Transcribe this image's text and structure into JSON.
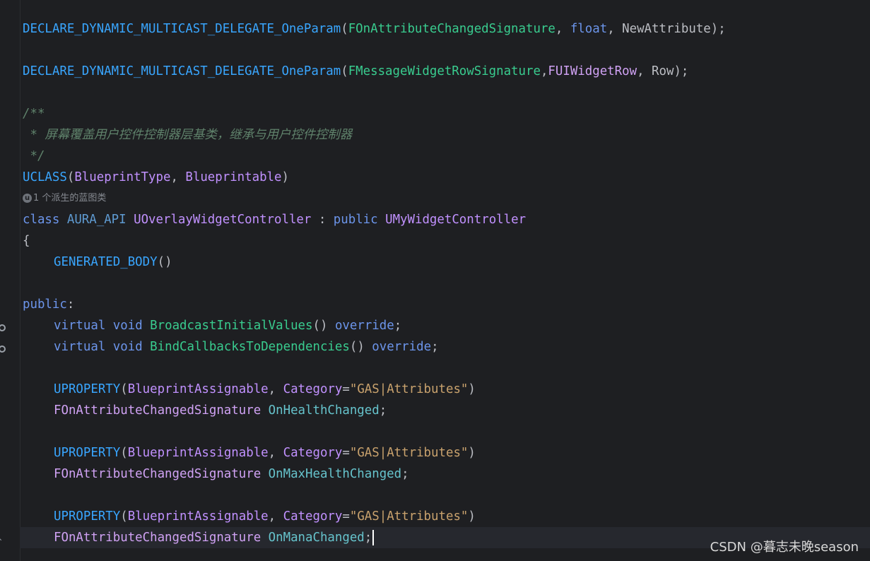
{
  "code": {
    "delegate1": {
      "macro": "DECLARE_DYNAMIC_MULTICAST_DELEGATE_OneParam",
      "open": "(",
      "sig": "FOnAttributeChangedSignature",
      "sep1": ", ",
      "ptype": "float",
      "sep2": ", ",
      "pname": "NewAttribute",
      "close": ");"
    },
    "delegate2": {
      "macro": "DECLARE_DYNAMIC_MULTICAST_DELEGATE_OneParam",
      "open": "(",
      "sig": "FMessageWidgetRowSignature",
      "sep1": ",",
      "ptype": "FUIWidgetRow",
      "sep2": ", ",
      "pname": "Row",
      "close": ");"
    },
    "comment": {
      "open": "/**",
      "body": " * 屏幕覆盖用户控件控制器层基类，继承与用户控件控制器",
      "close": " */"
    },
    "uclass": {
      "macro": "UCLASS",
      "open": "(",
      "arg1": "BlueprintType",
      "sep": ", ",
      "arg2": "Blueprintable",
      "close": ")"
    },
    "inlay_hint": {
      "icon": "u",
      "text": "1 个派生的蓝图类"
    },
    "class_decl": {
      "kw": "class",
      "api": "AURA_API",
      "name": "UOverlayWidgetController",
      "colon": " : ",
      "access": "public",
      "base": "UMyWidgetController"
    },
    "open_brace": "{",
    "generated_body": {
      "macro": "GENERATED_BODY",
      "parens": "()"
    },
    "public_label": {
      "kw": "public",
      "colon": ":"
    },
    "methods": [
      {
        "virtual": "virtual",
        "ret": "void",
        "name": "BroadcastInitialValues",
        "parens": "()",
        "override": "override",
        "end": ";"
      },
      {
        "virtual": "virtual",
        "ret": "void",
        "name": "BindCallbacksToDependencies",
        "parens": "()",
        "override": "override",
        "end": ";"
      }
    ],
    "properties": [
      {
        "macro": "UPROPERTY",
        "open": "(",
        "spec": "BlueprintAssignable",
        "sep": ", ",
        "cat_key": "Category",
        "eq": "=",
        "cat_val": "\"GAS|Attributes\"",
        "close": ")",
        "type": "FOnAttributeChangedSignature",
        "name": "OnHealthChanged",
        "end": ";"
      },
      {
        "macro": "UPROPERTY",
        "open": "(",
        "spec": "BlueprintAssignable",
        "sep": ", ",
        "cat_key": "Category",
        "eq": "=",
        "cat_val": "\"GAS|Attributes\"",
        "close": ")",
        "type": "FOnAttributeChangedSignature",
        "name": "OnMaxHealthChanged",
        "end": ";"
      },
      {
        "macro": "UPROPERTY",
        "open": "(",
        "spec": "BlueprintAssignable",
        "sep": ", ",
        "cat_key": "Category",
        "eq": "=",
        "cat_val": "\"GAS|Attributes\"",
        "close": ")",
        "type": "FOnAttributeChangedSignature",
        "name": "OnManaChanged",
        "end": ";"
      }
    ]
  },
  "watermark": "CSDN @暮志未晚season",
  "colors": {
    "background": "#1e1f22",
    "keyword": "#6c95eb",
    "macro": "#5f9bd2",
    "type": "#c191ff",
    "method": "#39cc8f",
    "property": "#66c3cc",
    "string": "#c9a26d",
    "comment": "#5f826b"
  }
}
